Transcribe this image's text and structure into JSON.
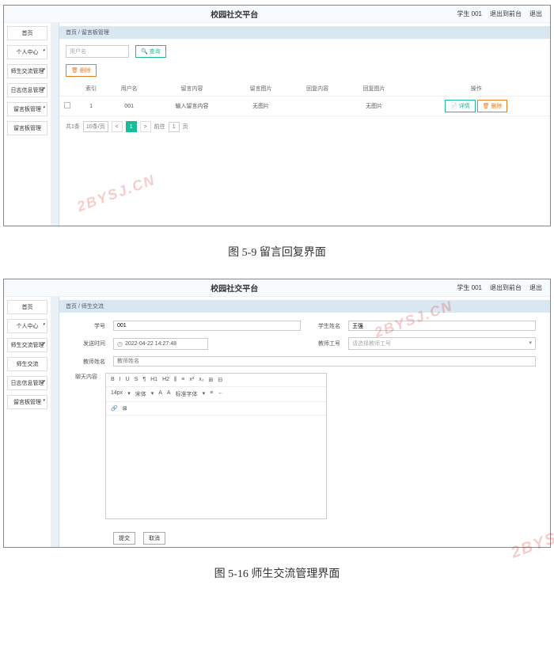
{
  "watermark": "2BYSJ.CN",
  "fig1": {
    "caption": "图 5-9 留言回复界面",
    "header": {
      "title": "校园社交平台",
      "user": "学生 001",
      "logout": "退出到前台",
      "exit": "退出"
    },
    "sidebar": [
      "首页",
      "个人中心",
      "师生交流管理",
      "日志信息管理",
      "留言板管理",
      "留言板管理"
    ],
    "breadcrumb": "首页 / 留言板管理",
    "search_placeholder": "用户名",
    "btn_search": "🔍 查询",
    "btn_delete": "🗑 删除",
    "columns": [
      "",
      "索引",
      "用户名",
      "留言内容",
      "留言图片",
      "回复内容",
      "回复图片",
      "操作"
    ],
    "row": {
      "cb": "",
      "index": "1",
      "user": "001",
      "msg": "输入留言内容",
      "img": "无图片",
      "reply": "",
      "rimg": "无图片"
    },
    "row_actions": {
      "detail": "📄 详情",
      "delete": "🗑 删除"
    },
    "pager": {
      "total": "共1条",
      "size": "10条/页",
      "prev": "<",
      "page": "1",
      "next": ">",
      "goto_pre": "前往",
      "goto_val": "1",
      "goto_suf": "页"
    }
  },
  "fig2": {
    "caption": "图 5-16 师生交流管理界面",
    "header": {
      "title": "校园社交平台",
      "user": "学生 001",
      "logout": "退出到前台",
      "exit": "退出"
    },
    "sidebar": [
      "首页",
      "个人中心",
      "师生交流管理",
      "师生交流",
      "日志信息管理",
      "留言板管理"
    ],
    "breadcrumb": "首页 / 师生交流",
    "labels": {
      "sid": "学号",
      "sname": "学生姓名",
      "time": "发送时间",
      "tid": "教师工号",
      "tname": "教师姓名",
      "content": "聊天内容"
    },
    "values": {
      "sid": "001",
      "sname": "王强",
      "time": "2022-04-22 14:27:48",
      "tid_placeholder": "请选择教师工号",
      "tname_placeholder": "教师姓名"
    },
    "editor_toolbar": [
      "B",
      "I",
      "U",
      "S",
      "¶",
      "H1",
      "H2",
      "⫼",
      "≡",
      "x²",
      "x₂",
      "⊞",
      "⊟"
    ],
    "editor_toolbar2": [
      "14px",
      "▾",
      "宋体",
      "▾",
      "A",
      "A",
      "标准字体",
      "▾",
      "≡",
      "←"
    ],
    "editor_toolbar3": [
      "🔗",
      "⊠"
    ],
    "btn_submit": "提交",
    "btn_cancel": "取消"
  }
}
